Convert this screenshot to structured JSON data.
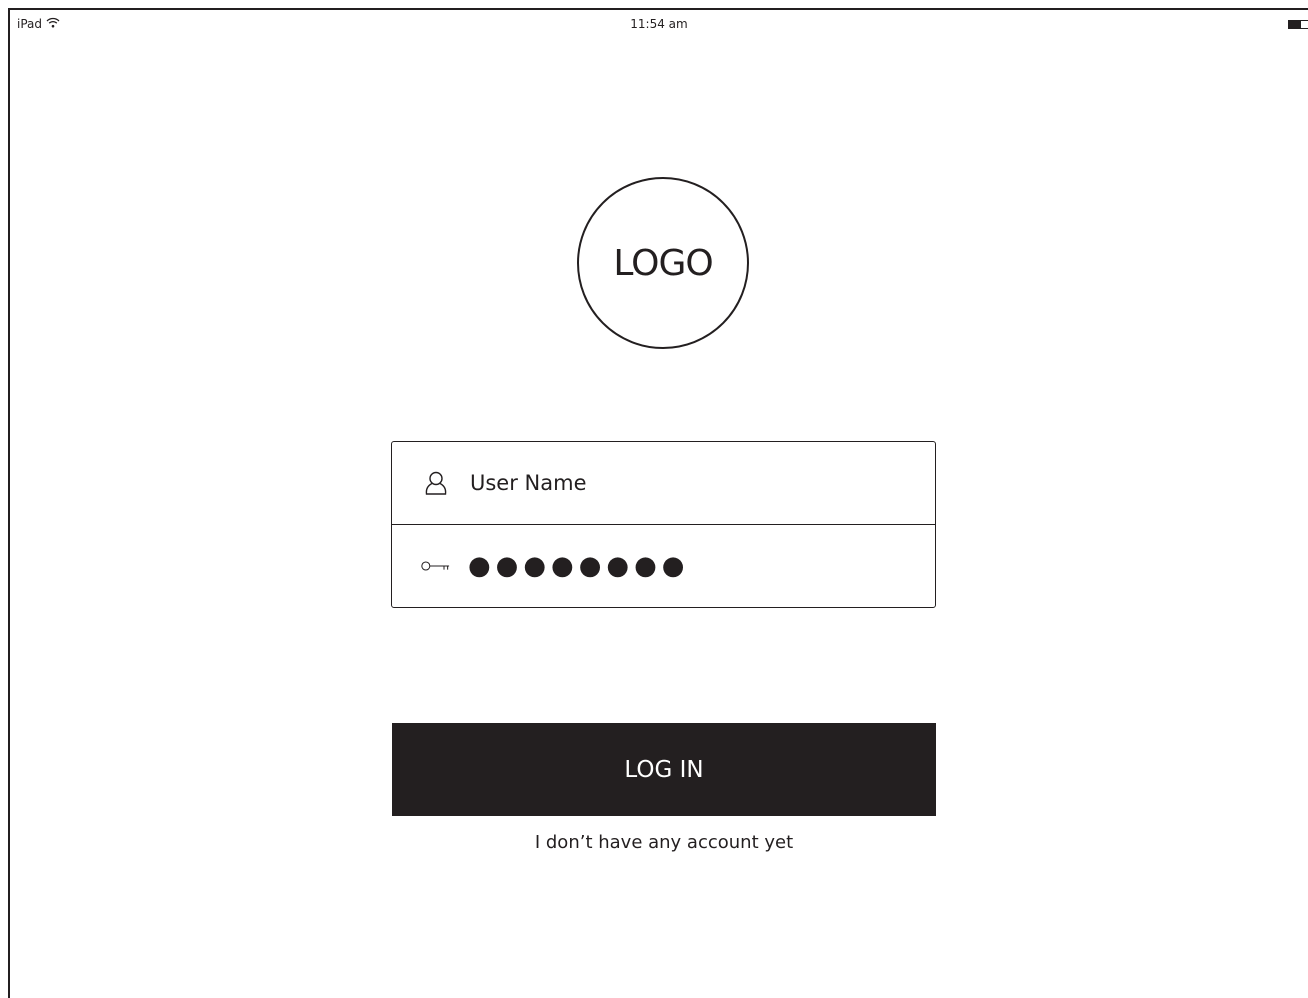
{
  "status_bar": {
    "device": "iPad",
    "time": "11:54 am",
    "battery_level": 0.6,
    "icons": [
      "wifi-icon",
      "battery-icon"
    ]
  },
  "logo": {
    "text": "LOGO"
  },
  "login_form": {
    "username": {
      "placeholder": "User Name",
      "value": "",
      "icon": "user-icon"
    },
    "password": {
      "masked_value": "●●●●●●●●",
      "icon": "key-icon"
    }
  },
  "actions": {
    "login_label": "LOG IN",
    "signup_link": "I don’t have any account yet"
  },
  "colors": {
    "primary": "#231f20",
    "background": "#ffffff",
    "button_text": "#ffffff"
  }
}
